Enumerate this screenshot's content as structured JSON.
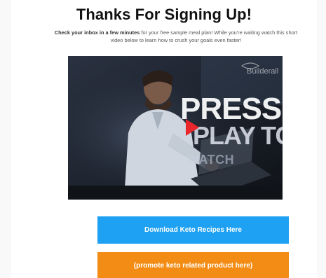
{
  "page": {
    "title": "Thanks For Signing Up!",
    "subtext_bold": "Check your inbox in a few minutes",
    "subtext_rest": " for your free sample meal plan! While you're waiting watch this short video below to learn how to crush your goals even faster!"
  },
  "video": {
    "overlay_line1": "PRESS",
    "overlay_line2": "PLAY TO",
    "overlay_line3": "WATCH",
    "brand": "Builderall",
    "play_icon": "play-icon"
  },
  "buttons": {
    "download_label": "Download Keto Recipes Here",
    "promote_label": "(promote keto related product here)"
  },
  "colors": {
    "blue_button": "#1ea1f2",
    "orange_button": "#f28c14",
    "play_red": "#e8262c"
  }
}
